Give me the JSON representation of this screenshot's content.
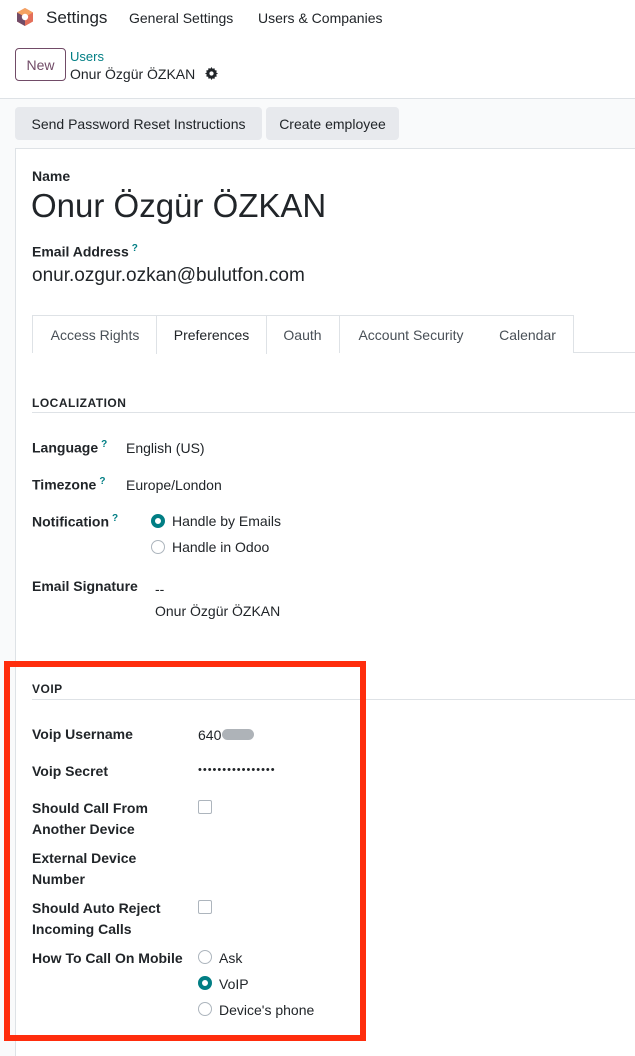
{
  "topbar": {
    "app_name": "Settings",
    "nav": [
      "General Settings",
      "Users & Companies"
    ]
  },
  "control_panel": {
    "new_label": "New",
    "breadcrumb_parent": "Users",
    "breadcrumb_current": "Onur Özgür ÖZKAN"
  },
  "actions": {
    "reset_password": "Send Password Reset Instructions",
    "create_employee": "Create employee"
  },
  "form": {
    "name_label": "Name",
    "name_value": "Onur Özgür ÖZKAN",
    "email_label": "Email Address",
    "email_value": "onur.ozgur.ozkan@bulutfon.com",
    "help_mark": "?"
  },
  "tabs": [
    {
      "label": "Access Rights"
    },
    {
      "label": "Preferences"
    },
    {
      "label": "Oauth"
    },
    {
      "label": "Account Security"
    },
    {
      "label": "Calendar"
    }
  ],
  "active_tab": "Preferences",
  "localization": {
    "title": "LOCALIZATION",
    "language_label": "Language",
    "language_value": "English (US)",
    "timezone_label": "Timezone",
    "timezone_value": "Europe/London",
    "notification_label": "Notification",
    "notification_options": [
      "Handle by Emails",
      "Handle in Odoo"
    ],
    "notification_selected": "Handle by Emails",
    "signature_label": "Email Signature",
    "signature_line1": "--",
    "signature_line2": "Onur Özgür ÖZKAN"
  },
  "voip": {
    "title": "VOIP",
    "username_label": "Voip Username",
    "username_value": "640",
    "secret_label": "Voip Secret",
    "secret_value": "••••••••••••••••",
    "call_from_device_label_1": "Should Call From",
    "call_from_device_label_2": "Another Device",
    "call_from_device_checked": false,
    "external_number_label_1": "External Device",
    "external_number_label_2": "Number",
    "auto_reject_label_1": "Should Auto Reject",
    "auto_reject_label_2": "Incoming Calls",
    "auto_reject_checked": false,
    "mobile_label": "How To Call On Mobile",
    "mobile_options": [
      "Ask",
      "VoIP",
      "Device's phone"
    ],
    "mobile_selected": "VoIP"
  },
  "colors": {
    "brand": "#714b67",
    "accent": "#017e84",
    "highlight": "#ff2d0d"
  }
}
